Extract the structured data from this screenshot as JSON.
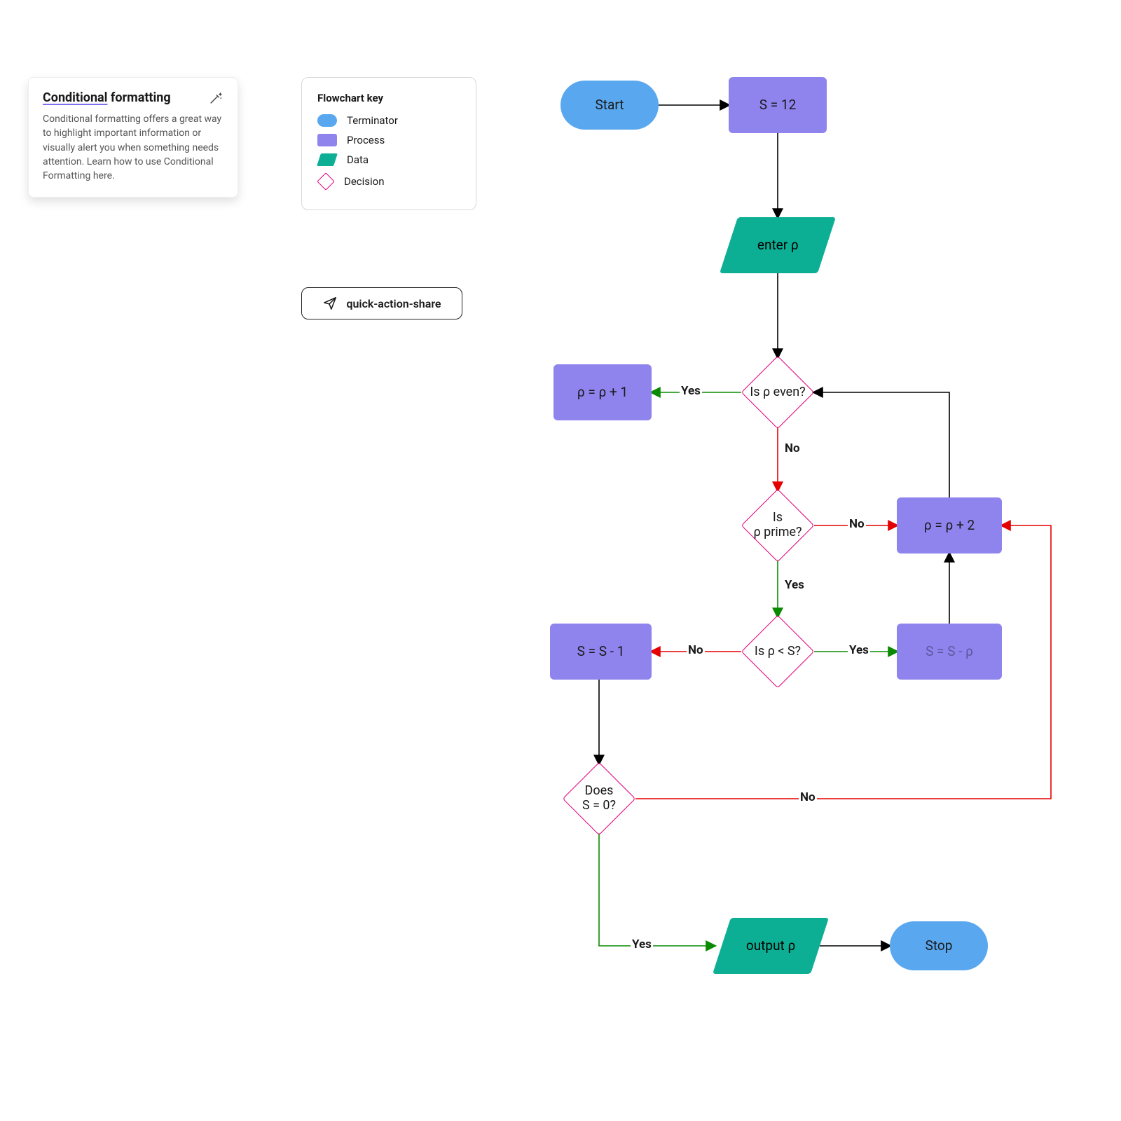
{
  "info_card": {
    "title_underlined": "Conditional",
    "title_rest": " formatting",
    "body": "Conditional formatting offers a great way to highlight important information or visually alert you when something needs attention. Learn how to use Conditional Formatting here."
  },
  "legend": {
    "heading": "Flowchart key",
    "items": {
      "terminator": "Terminator",
      "process": "Process",
      "data": "Data",
      "decision": "Decision"
    }
  },
  "share_button": {
    "label": "quick-action-share"
  },
  "nodes": {
    "start": "Start",
    "s12": "S = 12",
    "enter_p": "enter ρ",
    "is_even": "Is ρ even?",
    "p_plus_1": "ρ = ρ + 1",
    "is_prime": "Is\nρ prime?",
    "p_plus_2": "ρ = ρ + 2",
    "is_lt": "Is ρ < S?",
    "s_minus_1": "S = S - 1",
    "s_minus_p": "S = S - ρ",
    "s_zero": "Does\nS = 0?",
    "output_p": "output ρ",
    "stop": "Stop"
  },
  "labels": {
    "yes": "Yes",
    "no": "No"
  }
}
